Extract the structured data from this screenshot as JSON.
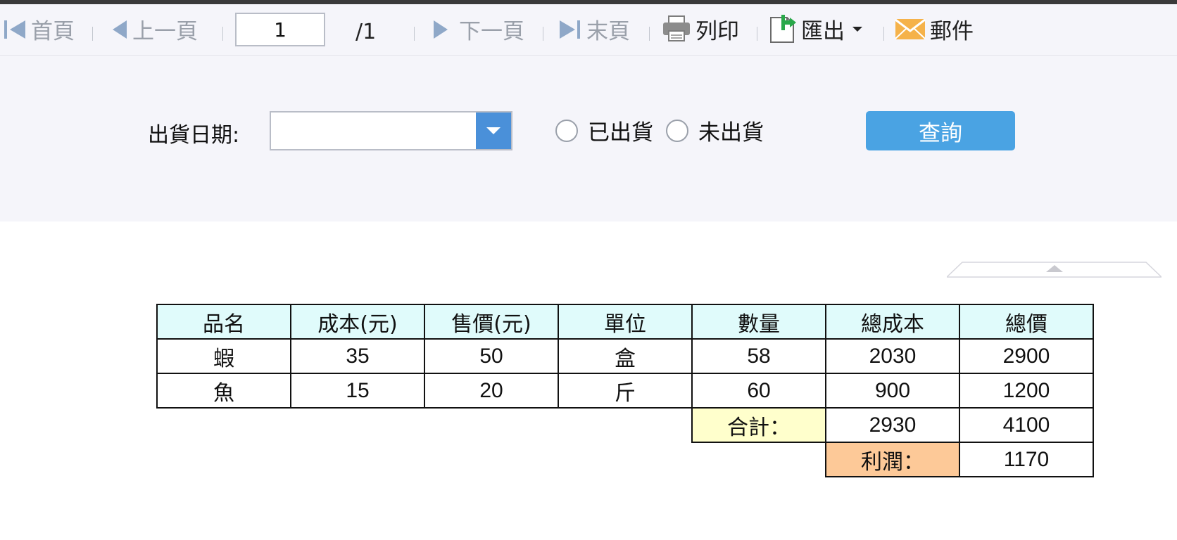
{
  "toolbar": {
    "first_label": "首頁",
    "prev_label": "上一頁",
    "page_value": "1",
    "page_total": "/1",
    "next_label": "下一頁",
    "last_label": "末頁",
    "print_label": "列印",
    "export_label": "匯出",
    "mail_label": "郵件"
  },
  "filter": {
    "date_label": "出貨日期:",
    "date_value": "",
    "radio_shipped": "已出貨",
    "radio_unshipped": "未出貨",
    "query_label": "查詢"
  },
  "report": {
    "headers": [
      "品名",
      "成本(元)",
      "售價(元)",
      "單位",
      "數量",
      "總成本",
      "總價"
    ],
    "rows": [
      [
        "蝦",
        "35",
        "50",
        "盒",
        "58",
        "2030",
        "2900"
      ],
      [
        "魚",
        "15",
        "20",
        "斤",
        "60",
        "900",
        "1200"
      ]
    ],
    "total_label": "合計：",
    "total_cost": "2930",
    "total_price": "4100",
    "profit_label": "利潤：",
    "profit_value": "1170"
  },
  "colors": {
    "header_bg": "#e0fbfb",
    "total_bg": "#ffffcc",
    "profit_bg": "#fdc998",
    "query_button": "#4aa3e3",
    "date_dropdown": "#4a90d9"
  },
  "icons": [
    "first-page-icon",
    "prev-page-icon",
    "next-page-icon",
    "last-page-icon",
    "print-icon",
    "export-icon",
    "dropdown-caret-icon",
    "mail-icon",
    "calendar-dropdown-icon",
    "collapse-arrow-icon"
  ]
}
